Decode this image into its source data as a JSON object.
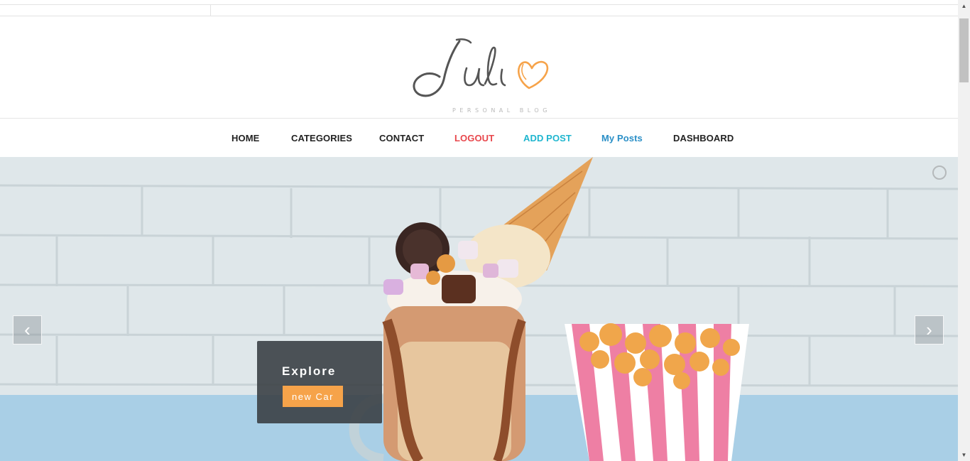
{
  "logo": {
    "title": "Juli",
    "tagline": "PERSONAL BLOG"
  },
  "nav": {
    "items": [
      {
        "label": "HOME",
        "color": "#222222"
      },
      {
        "label": "CATEGORIES",
        "color": "#222222"
      },
      {
        "label": "CONTACT",
        "color": "#222222"
      },
      {
        "label": "LOGOUT",
        "color": "#e8474c"
      },
      {
        "label": "ADD POST",
        "color": "#1fb6cf"
      },
      {
        "label": "My Posts",
        "color": "#2a8fc7"
      },
      {
        "label": "DASHBOARD",
        "color": "#222222"
      }
    ]
  },
  "slider": {
    "prev_icon": "chevron-left-icon",
    "prev_glyph": "‹",
    "next_icon": "chevron-right-icon",
    "next_glyph": "›",
    "caption_title": "Explore",
    "caption_button": "new Car"
  },
  "colors": {
    "accent": "#f6a34a",
    "logout": "#e8474c",
    "add_post": "#1fb6cf",
    "my_posts": "#2a8fc7"
  }
}
